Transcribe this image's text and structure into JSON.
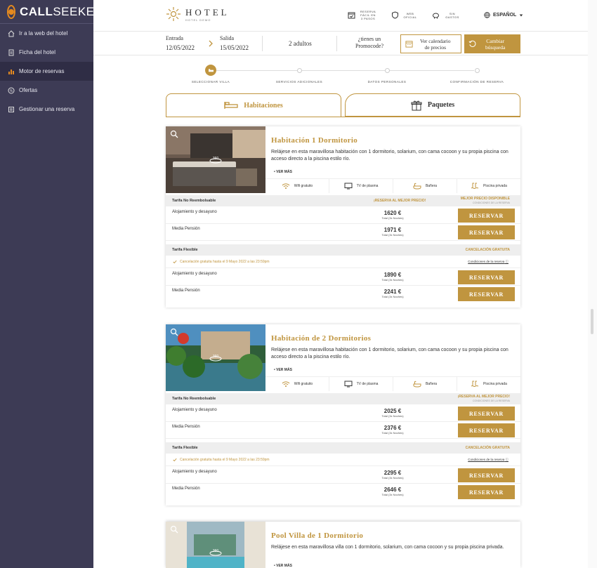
{
  "app": {
    "brand_prefix": "CALL",
    "brand_suffix": "SEEKER"
  },
  "sidebar": {
    "items": [
      {
        "label": "Ir a la web del hotel",
        "icon": "home-icon",
        "active": false
      },
      {
        "label": "Ficha del hotel",
        "icon": "document-icon",
        "active": false
      },
      {
        "label": "Motor de reservas",
        "icon": "bar-chart-icon",
        "active": true
      },
      {
        "label": "Ofertas",
        "icon": "percent-icon",
        "active": false
      },
      {
        "label": "Gestionar una reserva",
        "icon": "list-icon",
        "active": false
      }
    ]
  },
  "header": {
    "hotel_name": "HOTEL",
    "hotel_sub": "HOTEL DEMO",
    "links": [
      {
        "label": "RESERVA FÁCIL EN 3 PASOS",
        "icon": "calendar-check-icon"
      },
      {
        "label": "WEB OFICIAL",
        "icon": "shield-icon"
      },
      {
        "label": "SIN GASTOS",
        "icon": "piggy-bank-icon"
      }
    ],
    "language": "ESPAÑOL"
  },
  "search": {
    "entrada_label": "Entrada",
    "entrada_date": "12/05/2022",
    "salida_label": "Salida",
    "salida_date": "15/05/2022",
    "guests": "2 adultos",
    "promo_line1": "¿tienes un",
    "promo_line2": "Promocode?",
    "calendar_line1": "Ver calendario",
    "calendar_line2": "de precios",
    "change_line1": "Cambiar",
    "change_line2": "búsqueda"
  },
  "steps": [
    {
      "label": "SELECCIONAR VILLA",
      "active": true
    },
    {
      "label": "SERVICIOS ADICIONALES",
      "active": false
    },
    {
      "label": "DATOS PERSONALES",
      "active": false
    },
    {
      "label": "CONFIRMACIÓN DE RESERVA",
      "active": false
    }
  ],
  "tabs": {
    "rooms": "Habitaciones",
    "packages": "Paquetes"
  },
  "rooms": [
    {
      "title": "Habitación 1 Dormitorio",
      "description": "Relájese en esta maravillosa habitación con 1 dormitorio, solarium, con cama cocoon y su propia piscina con acceso directo a la piscina estilo río.",
      "ver_mas": "VER MÁS",
      "amenities": [
        "Wifi gratuito",
        "TV de plasma",
        "Bañera",
        "Piscina privada"
      ],
      "rate_nr": {
        "name": "Tarifa No Reembolsable",
        "promo": "¡RESERVA AL MEJOR PRECIO!",
        "badge": "MEJOR PRECIO DISPONIBLE",
        "badge_sub": "CONDICIONES DE LA RESERVA",
        "rows": [
          {
            "label": "Alojamiento y desayuno",
            "price": "1620 €",
            "total": "Total (3x Noches)",
            "button": "RESERVAR"
          },
          {
            "label": "Media Pensión",
            "price": "1971 €",
            "total": "Total (3x Noches)",
            "button": "RESERVAR"
          }
        ]
      },
      "rate_flex": {
        "name": "Tarifa Flexible",
        "badge": "CANCELACIÓN GRATUITA",
        "cancel_text": "Cancelación gratuita hasta el 9 Mayo 2022 a las 23:59pm",
        "conditions": "Condiciones de la reserva",
        "rows": [
          {
            "label": "Alojamiento y desayuno",
            "price": "1890 €",
            "total": "Total (3x Noches)",
            "button": "RESERVAR"
          },
          {
            "label": "Media Pensión",
            "price": "2241 €",
            "total": "Total (3x Noches)",
            "button": "RESERVAR"
          }
        ]
      }
    },
    {
      "title": "Habitación de 2 Dormitorios",
      "description": "Relájese en esta maravillosa habitación con 1 dormitorio, solarium, con cama cocoon y su propia piscina con acceso directo a la piscina estilo río.",
      "ver_mas": "VER MÁS",
      "amenities": [
        "Wifi gratuito",
        "TV de plasma",
        "Bañera",
        "Piscina privada"
      ],
      "rate_nr": {
        "name": "Tarifa No Reembolsable",
        "promo": "",
        "badge": "¡RESERVA AL MEJOR PRECIO!",
        "badge_sub": "CONDICIONES DE LA RESERVA",
        "rows": [
          {
            "label": "Alojamiento y desayuno",
            "price": "2025 €",
            "total": "Total (3x Noches)",
            "button": "RESERVAR"
          },
          {
            "label": "Media Pensión",
            "price": "2376 €",
            "total": "Total (3x Noches)",
            "button": "RESERVAR"
          }
        ]
      },
      "rate_flex": {
        "name": "Tarifa Flexible",
        "badge": "CANCELACIÓN GRATUITA",
        "cancel_text": "Cancelación gratuita hasta el 9 Mayo 2022 a las 23:59pm",
        "conditions": "Condiciones de la reserva",
        "rows": [
          {
            "label": "Alojamiento y desayuno",
            "price": "2295 €",
            "total": "Total (3x Noches)",
            "button": "RESERVAR"
          },
          {
            "label": "Media Pensión",
            "price": "2646 €",
            "total": "Total (3x Noches)",
            "button": "RESERVAR"
          }
        ]
      }
    },
    {
      "title": "Pool Villa de 1 Dormitorio",
      "description": "Relájese en esta maravillosa villa con 1 dormitorio, solarium, con cama cocoon y su propia piscina privada.",
      "ver_mas": "VER MÁS"
    }
  ],
  "colors": {
    "gold": "#c0953f",
    "sidebar": "#3d3b55",
    "sidebar_active": "#2f2d45",
    "brand_orange": "#e58a1f"
  }
}
